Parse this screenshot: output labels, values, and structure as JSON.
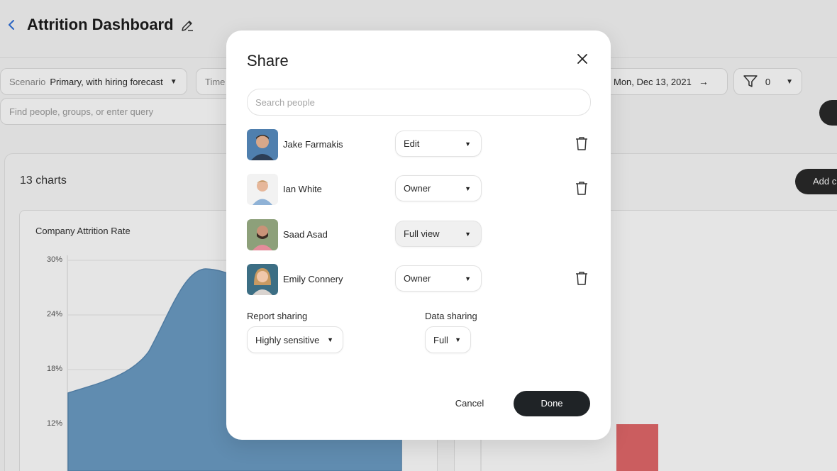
{
  "dashboard": {
    "title": "Attrition Dashboard",
    "filters": {
      "scenario_label": "Scenario",
      "scenario_value": "Primary, with hiring forecast",
      "time_label": "Time",
      "date_value": "Mon, Dec 13, 2021",
      "filter_count": "0"
    },
    "query_placeholder": "Find people, groups, or enter query",
    "charts_count": "13 charts",
    "add_label": "Add c",
    "chart_title": "Company Attrition Rate",
    "y_ticks": [
      "30%",
      "24%",
      "18%",
      "12%"
    ]
  },
  "share": {
    "title": "Share",
    "search_placeholder": "Search people",
    "people": [
      {
        "name": "Jake Farmakis",
        "role": "Edit",
        "removable": true
      },
      {
        "name": "Ian White",
        "role": "Owner",
        "removable": true
      },
      {
        "name": "Saad Asad",
        "role": "Full view",
        "removable": false
      },
      {
        "name": "Emily Connery",
        "role": "Owner",
        "removable": true
      }
    ],
    "report_sharing_label": "Report sharing",
    "report_sharing_value": "Highly sensitive",
    "data_sharing_label": "Data sharing",
    "data_sharing_value": "Full",
    "cancel_label": "Cancel",
    "done_label": "Done"
  },
  "colors": {
    "area_fill": "#6b9cc4",
    "bar_red": "#e2686a",
    "accent_blue": "#2e6fd8",
    "dark_button": "#1f2326"
  },
  "icons": {
    "back": "chevron-left-icon",
    "edit": "pencil-icon",
    "filter": "funnel-icon",
    "close": "close-icon",
    "trash": "trash-icon"
  }
}
